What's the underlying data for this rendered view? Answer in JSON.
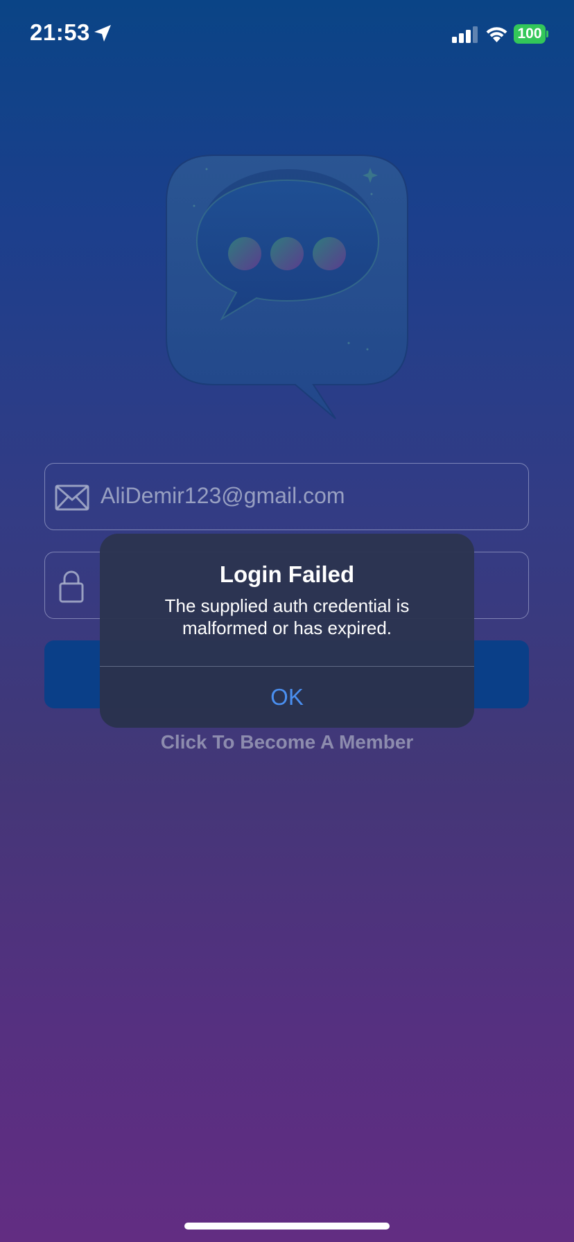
{
  "status_bar": {
    "time": "21:53",
    "battery_level": "100",
    "icons": [
      "location-arrow-icon",
      "cellular-signal-icon",
      "wifi-icon",
      "battery-icon"
    ]
  },
  "logo": {
    "icon": "chat-bubble-icon"
  },
  "form": {
    "email_value": "AliDemir123@gmail.com",
    "email_icon": "mail-icon",
    "password_icon": "lock-icon",
    "login_button_label": "",
    "member_link": "Click To Become A Member"
  },
  "alert": {
    "title": "Login Failed",
    "message": "The supplied auth credential is malformed or has expired.",
    "ok_label": "OK"
  },
  "colors": {
    "background_top": "#0a4486",
    "background_bottom": "#622d82",
    "battery_green": "#33c759",
    "alert_button": "#4a8ff0",
    "login_button": "#0a3f88"
  }
}
